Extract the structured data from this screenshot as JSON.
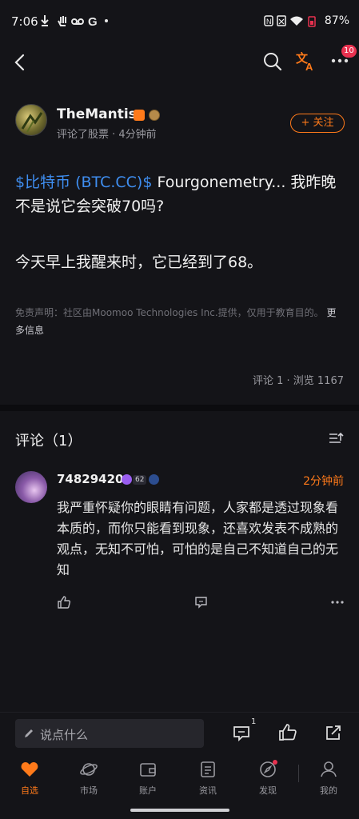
{
  "status_bar": {
    "time": "7:06",
    "left_icons": [
      "download-icon",
      "hand-icon",
      "voicemail-icon",
      "google-icon",
      "dot-icon"
    ],
    "battery": "87%"
  },
  "nav": {
    "notification_count": "10"
  },
  "author": {
    "name": "TheMantis",
    "meta": "评论了股票 · 4分钟前",
    "follow_label": "+ 关注"
  },
  "post": {
    "ticker": "$比特币 (BTC.CC)$",
    "line1_rest": " Fourgonemetry... 我昨晚不是说它会突破70吗?",
    "line2": "今天早上我醒来时，它已经到了68。",
    "disclaimer": "免责声明：社区由Moomoo Technologies Inc.提供，仅用于教育目的。",
    "more_info": "更多信息",
    "stats": "评论 1 · 浏览 1167"
  },
  "comments": {
    "title": "评论（1）",
    "items": [
      {
        "name": "74829420",
        "level": "62",
        "time": "2分钟前",
        "text": "我严重怀疑你的眼睛有问题，人家都是透过现象看本质的，而你只能看到现象，还喜欢发表不成熟的观点，无知不可怕，可怕的是自己不知道自己的无知"
      }
    ]
  },
  "action_bar": {
    "placeholder": "说点什么",
    "comment_count": "1"
  },
  "tabs": [
    {
      "label": "自选",
      "icon": "heart-icon"
    },
    {
      "label": "市场",
      "icon": "planet-icon"
    },
    {
      "label": "账户",
      "icon": "wallet-icon"
    },
    {
      "label": "资讯",
      "icon": "news-icon"
    },
    {
      "label": "发现",
      "icon": "compass-icon"
    },
    {
      "label": "我的",
      "icon": "person-icon"
    }
  ],
  "colors": {
    "accent": "#ff7a1a",
    "link": "#3f8ef0",
    "badge": "#e8314f",
    "background": "#141418"
  }
}
